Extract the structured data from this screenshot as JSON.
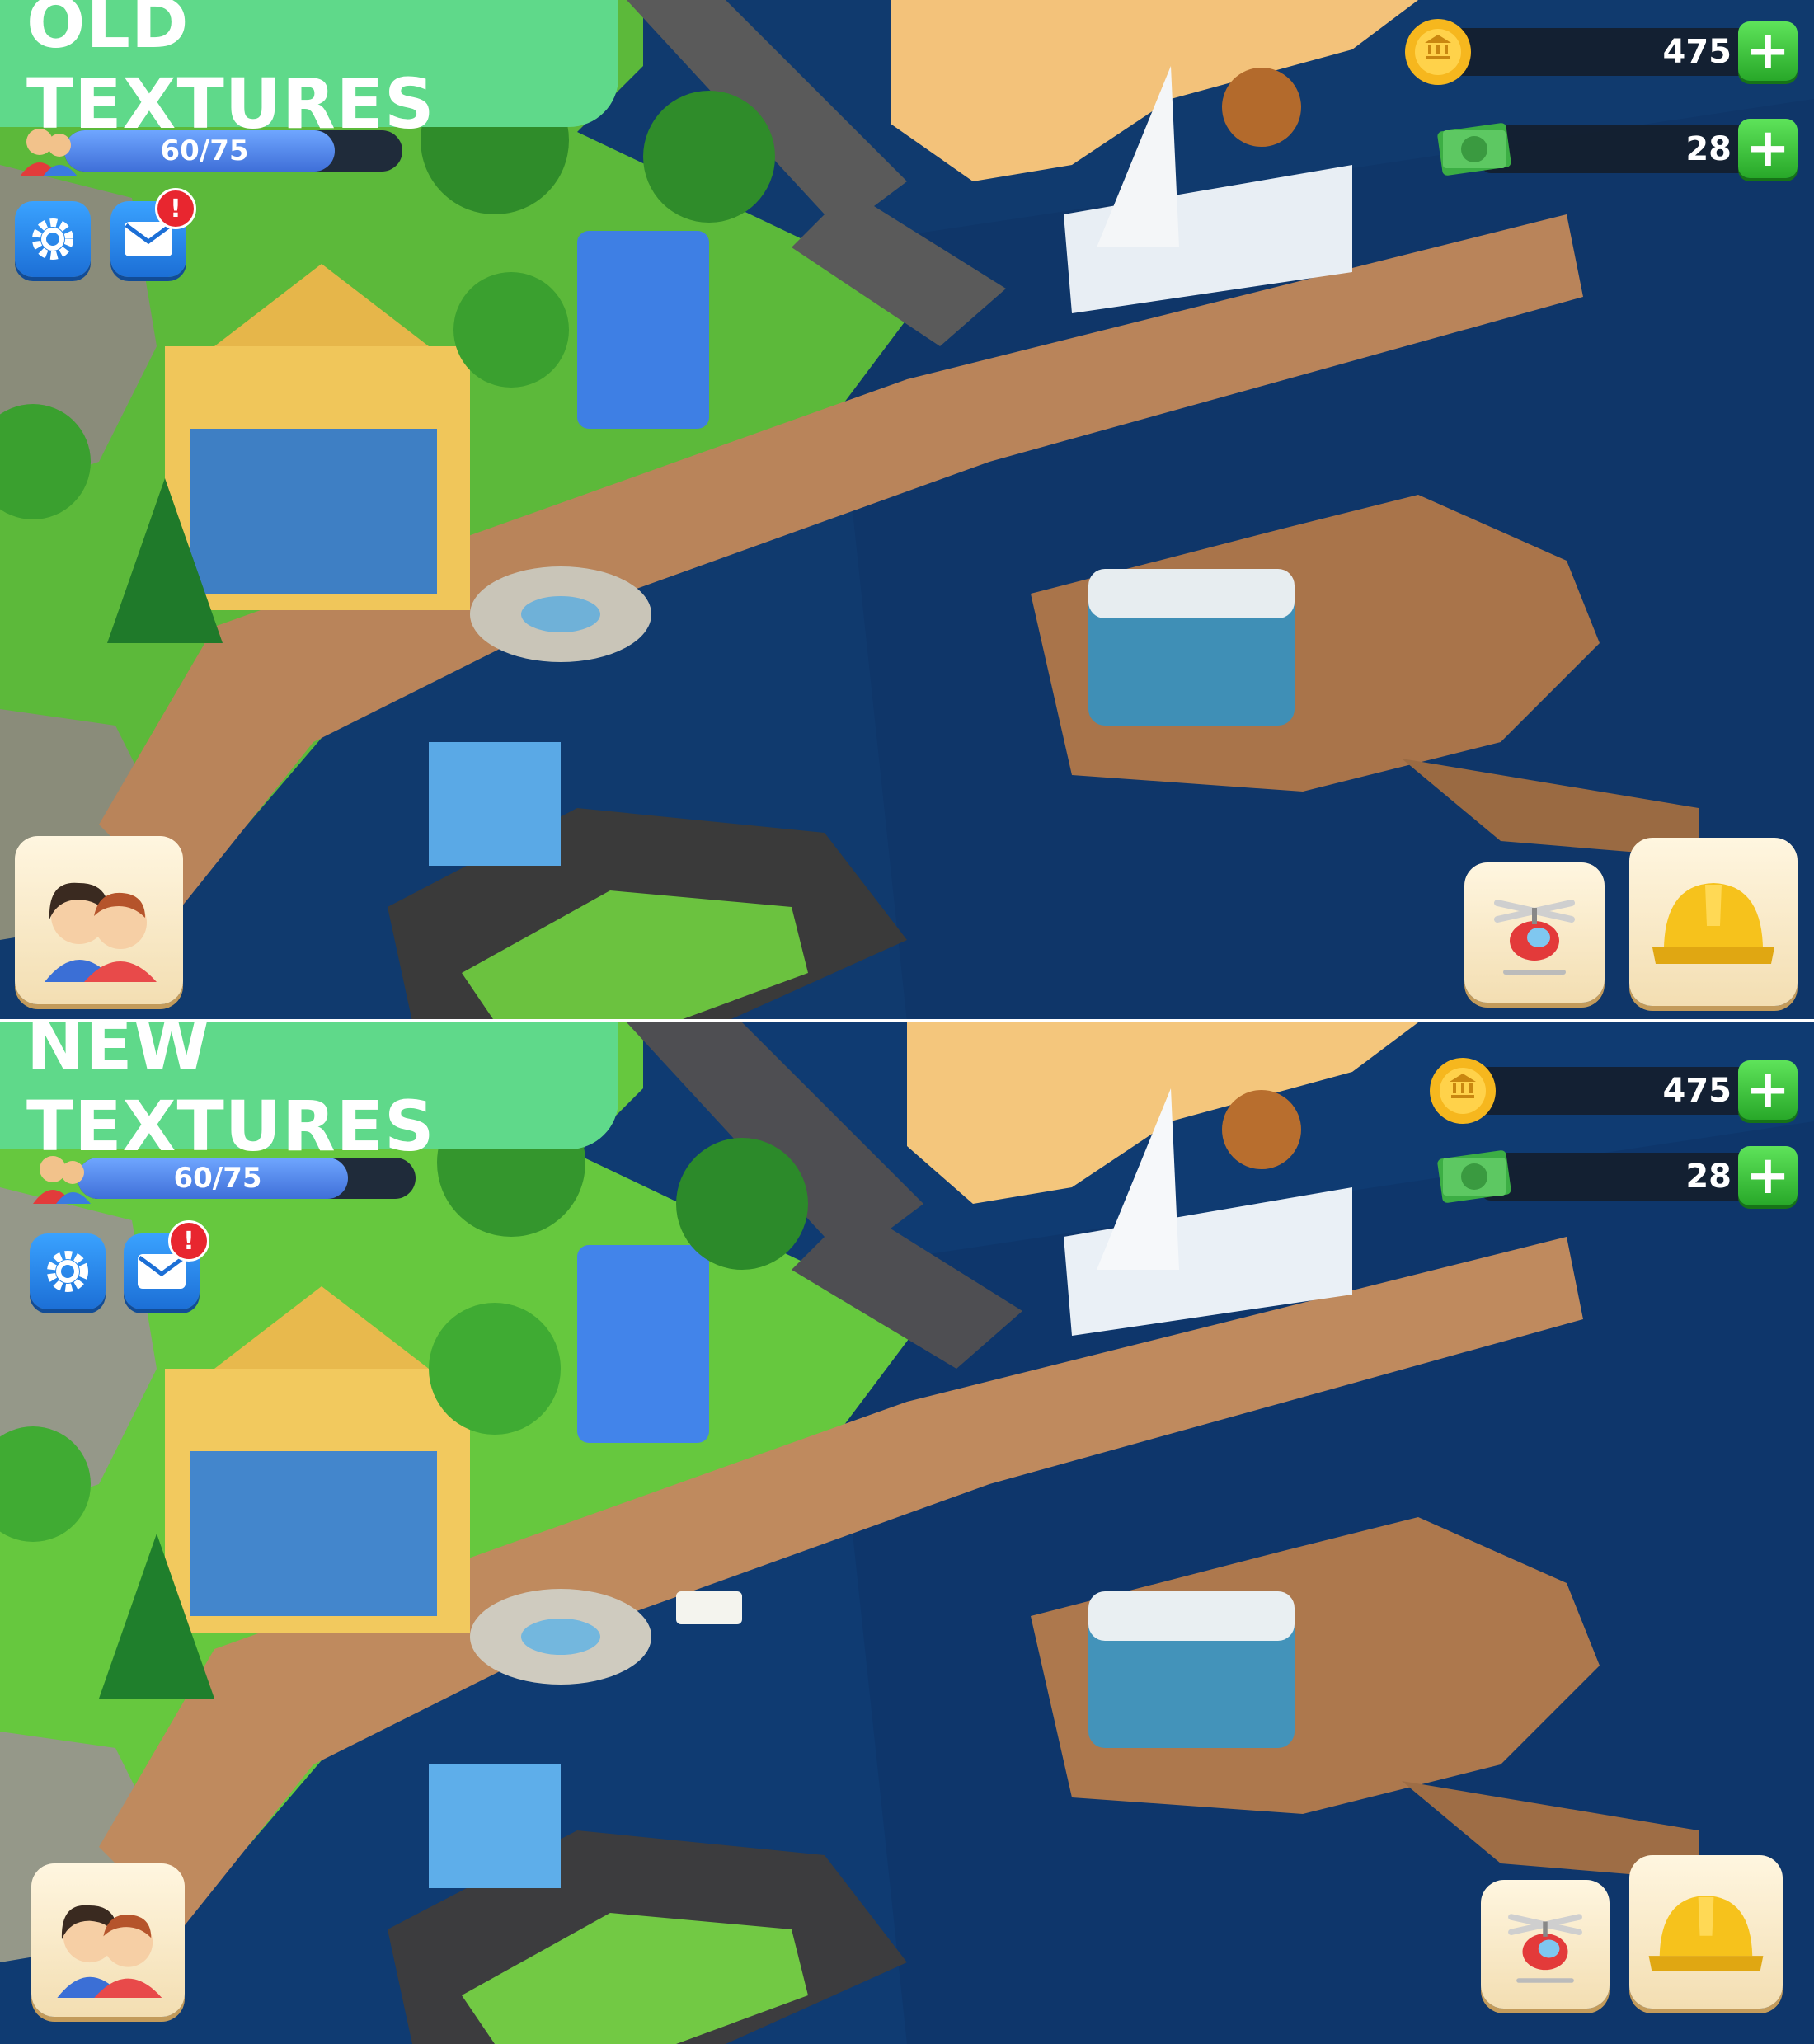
{
  "panels": [
    {
      "label": "OLD TEXTURES",
      "xp": {
        "text": "60/75",
        "fraction": 0.8
      },
      "coins": "475",
      "cash": "28"
    },
    {
      "label": "NEW TEXTURES",
      "xp": {
        "text": "60/75",
        "fraction": 0.8
      },
      "coins": "475",
      "cash": "28"
    }
  ],
  "icons": {
    "settings": "gear-icon",
    "mail": "envelope-icon",
    "mail_badge": "!",
    "coin": "coin-icon",
    "cash": "cash-icon",
    "plus": "+",
    "friends": "friends-icon",
    "helicopter": "helicopter-icon",
    "build": "hard-hat-icon"
  },
  "colors": {
    "banner": "#5fd98a",
    "water": "#103a6e",
    "grass": "#5cb93a",
    "sand": "#f3c27a",
    "road": "#5a5a5a",
    "deck": "#b9845a"
  }
}
